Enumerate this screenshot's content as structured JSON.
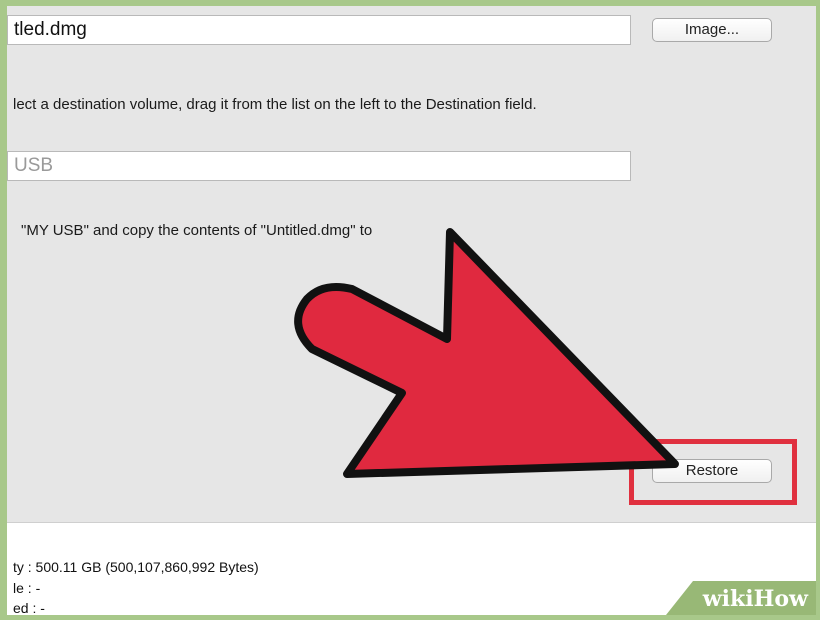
{
  "source": {
    "value": "tled.dmg",
    "image_button_label": "Image..."
  },
  "instruction_text": "lect a destination volume, drag it from the list on the left to the Destination field.",
  "destination": {
    "placeholder_value": "USB"
  },
  "confirm_text": "\"MY USB\" and copy the contents of \"Untitled.dmg\" to",
  "restore_button_label": "Restore",
  "info": {
    "capacity": "ty : 500.11 GB (500,107,860,992 Bytes)",
    "line2": "le : -",
    "line3": "ed : -"
  },
  "watermark": {
    "part1": "wiki",
    "part2": "How"
  },
  "colors": {
    "arrow_fill": "#e0293f",
    "highlight_border": "#e0303f",
    "frame": "#a8c88a",
    "watermark_bg": "#98b876"
  },
  "icons": {
    "pointer": "red-arrow-icon"
  }
}
